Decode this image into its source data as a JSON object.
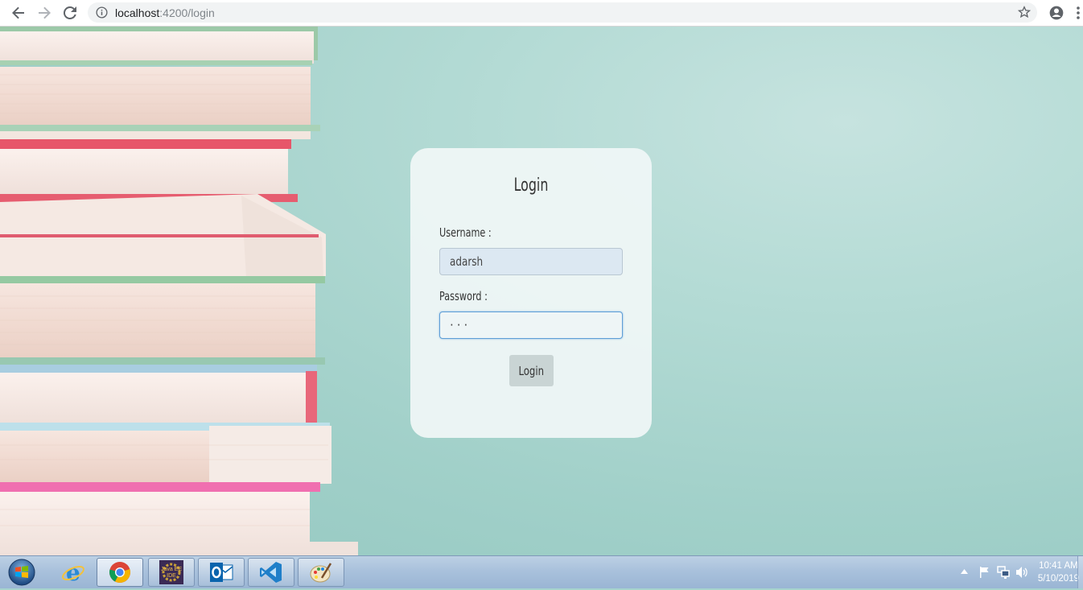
{
  "browser": {
    "url_host": "localhost",
    "url_path": ":4200/login"
  },
  "login": {
    "title": "Login",
    "username_label": "Username :",
    "username_value": "adarsh",
    "password_label": "Password :",
    "password_value": "···",
    "submit_label": "Login"
  },
  "taskbar": {
    "pinned": [
      "internet-explorer",
      "chrome",
      "java-ee-ide",
      "outlook",
      "visual-studio-code",
      "paint"
    ],
    "java_ide_text_1": "Java EE",
    "java_ide_text_2": "IDE"
  },
  "clock": {
    "time": "10:41 AM",
    "date": "5/10/2019"
  },
  "colors": {
    "page_bg": "#a6d3cd",
    "card_bg": "#f0f6f6",
    "focus_border": "#5e9ed6",
    "taskbar": "#a9c1dc"
  }
}
